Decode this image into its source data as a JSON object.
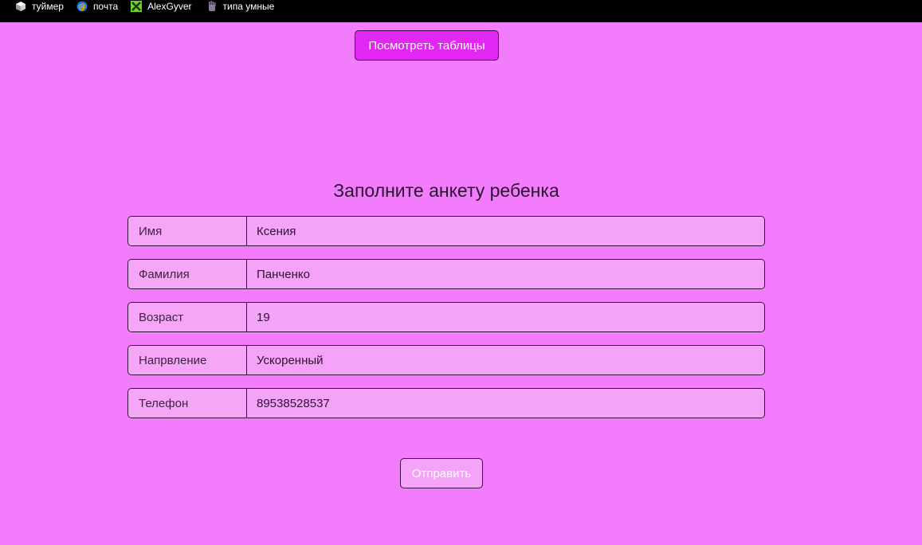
{
  "bookmarks": [
    {
      "label": "туймер",
      "icon": "cube-icon"
    },
    {
      "label": "почта",
      "icon": "at-sign-icon"
    },
    {
      "label": "AlexGyver",
      "icon": "tools-icon"
    },
    {
      "label": "типа умные",
      "icon": "hand-icon"
    }
  ],
  "header": {
    "view_tables_label": "Посмотреть таблицы"
  },
  "form": {
    "title": "Заполните анкету ребенка",
    "fields": [
      {
        "label": "Имя",
        "value": "Ксения"
      },
      {
        "label": "Фамилия",
        "value": "Панченко"
      },
      {
        "label": "Возраст",
        "value": "19"
      },
      {
        "label": "Напрвление",
        "value": "Ускоренный"
      },
      {
        "label": "Телефон",
        "value": "89538528537"
      }
    ],
    "submit_label": "Отправить"
  },
  "colors": {
    "page_background": "#f27cfc",
    "primary_button": "#e227f2",
    "field_background": "#f5a3f8",
    "bookmarks_bar": "#000000"
  }
}
